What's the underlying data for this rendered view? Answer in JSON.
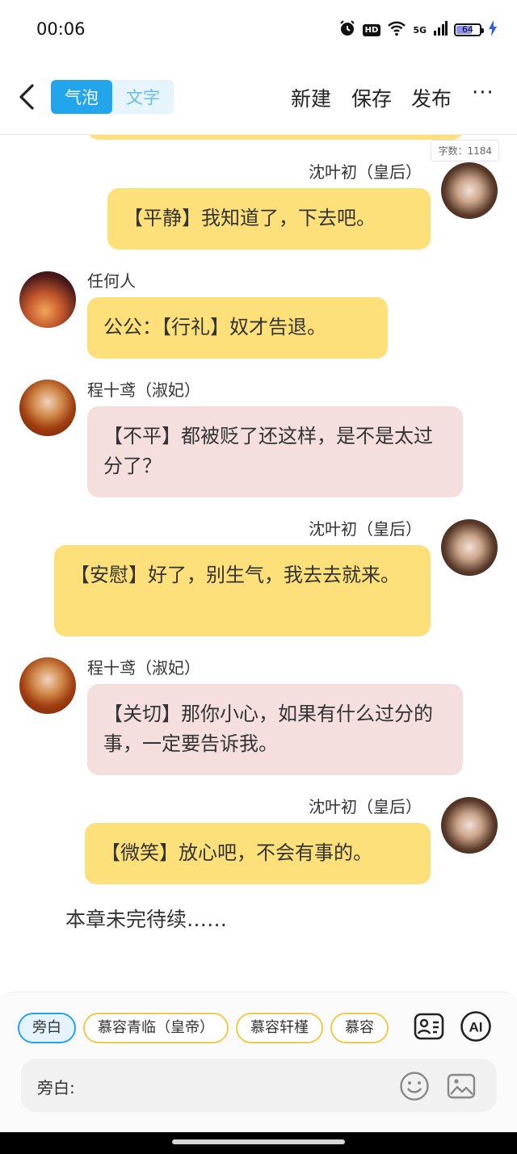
{
  "status_bar": {
    "time": "00:06",
    "hd_label": "HD",
    "network_label": "5G",
    "battery": "64"
  },
  "header": {
    "tab_bubble": "气泡",
    "tab_text": "文字",
    "new_label": "新建",
    "save_label": "保存",
    "publish_label": "发布",
    "more_label": "···"
  },
  "word_count": "字数：1184",
  "messages": [
    {
      "speaker": "沈叶初（皇后）",
      "text": "【平静】我知道了，下去吧。",
      "side": "right",
      "bubble_color": "#fde07a"
    },
    {
      "speaker": "任何人",
      "text": "公公：【行礼】奴才告退。",
      "side": "left",
      "bubble_color": "#fde07a"
    },
    {
      "speaker": "程十鸢（淑妃）",
      "text": "【不平】都被贬了还这样，是不是太过分了？",
      "side": "left",
      "bubble_color": "#f5dede"
    },
    {
      "speaker": "沈叶初（皇后）",
      "text": "【安慰】好了，别生气，我去去就来。",
      "side": "right",
      "bubble_color": "#fde07a"
    },
    {
      "speaker": "程十鸢（淑妃）",
      "text": "【关切】那你小心，如果有什么过分的事，一定要告诉我。",
      "side": "left",
      "bubble_color": "#f5dede"
    },
    {
      "speaker": "沈叶初（皇后）",
      "text": "【微笑】放心吧，不会有事的。",
      "side": "right",
      "bubble_color": "#fde07a"
    }
  ],
  "end_text": "本章未完待续……",
  "character_chips": [
    "旁白",
    "慕容青临（皇帝）",
    "慕容轩槿",
    "慕容"
  ],
  "selected_chip": "旁白",
  "ai_label": "AI",
  "input": {
    "label": "旁白:"
  },
  "colors": {
    "accent": "#23a5ec",
    "yellow_bubble": "#fde07a",
    "pink_bubble": "#f5dede",
    "chip_border": "#f2c94c"
  }
}
